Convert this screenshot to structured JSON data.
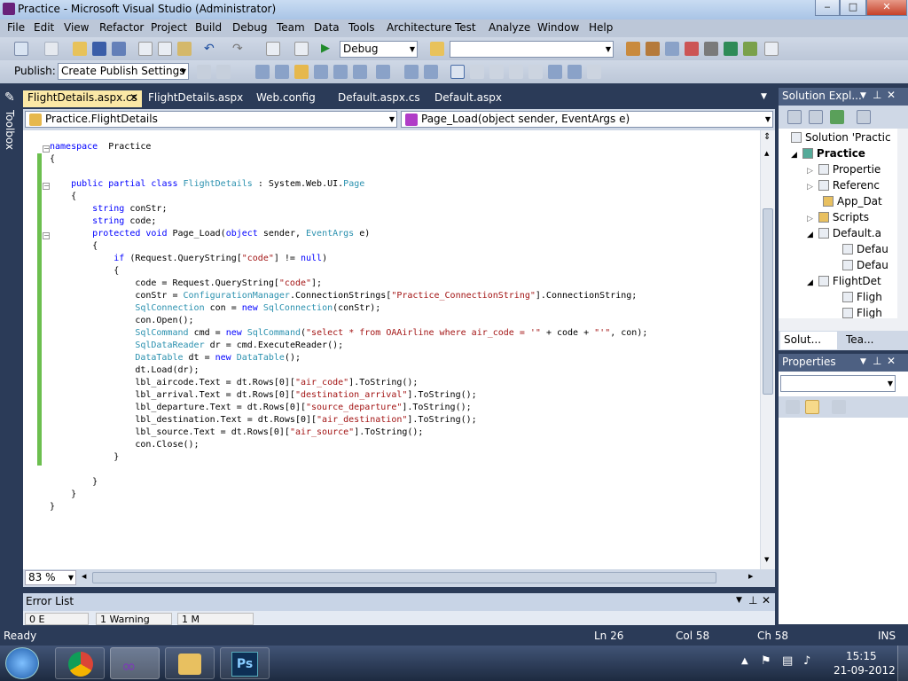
{
  "window": {
    "title": "Practice - Microsoft Visual Studio (Administrator)",
    "min": "‒",
    "max": "□",
    "close": "✕"
  },
  "menu": [
    "File",
    "Edit",
    "View",
    "Refactor",
    "Project",
    "Build",
    "Debug",
    "Team",
    "Data",
    "Tools",
    "Architecture",
    "Test",
    "Analyze",
    "Window",
    "Help"
  ],
  "toolbar": {
    "config": "Debug",
    "platform": "",
    "publish_label": "Publish:",
    "publish_profile": "Create Publish Settings"
  },
  "toolbox_label": "Toolbox",
  "tabs": [
    "FlightDetails.aspx.cs",
    "FlightDetails.aspx",
    "Web.config",
    "Default.aspx.cs",
    "Default.aspx"
  ],
  "tab_close": "✕",
  "nav": {
    "class": "Practice.FlightDetails",
    "member": "Page_Load(object sender, EventArgs e)"
  },
  "code_lines": [
    [
      [
        "kw",
        "namespace"
      ],
      [
        "",
        "  Practice"
      ]
    ],
    [
      [
        "",
        "{"
      ]
    ],
    [
      [
        "",
        ""
      ]
    ],
    [
      [
        "",
        "    "
      ],
      [
        "kw",
        "public partial class"
      ],
      [
        "",
        ""
      ],
      [
        "ty",
        " FlightDetails"
      ],
      [
        "",
        " : System.Web.UI."
      ],
      [
        "ty",
        "Page"
      ]
    ],
    [
      [
        "",
        "    {"
      ]
    ],
    [
      [
        "",
        "        "
      ],
      [
        "kw",
        "string"
      ],
      [
        "",
        " conStr;"
      ]
    ],
    [
      [
        "",
        "        "
      ],
      [
        "kw",
        "string"
      ],
      [
        "",
        " code;"
      ]
    ],
    [
      [
        "",
        "        "
      ],
      [
        "kw",
        "protected void"
      ],
      [
        "",
        " Page_Load("
      ],
      [
        "kw",
        "object"
      ],
      [
        "",
        " sender, "
      ],
      [
        "ty",
        "EventArgs"
      ],
      [
        "",
        " e)"
      ]
    ],
    [
      [
        "",
        "        {"
      ]
    ],
    [
      [
        "",
        "            "
      ],
      [
        "kw",
        "if"
      ],
      [
        "",
        " (Request.QueryString["
      ],
      [
        "st",
        "\"code\""
      ],
      [
        "",
        "] != "
      ],
      [
        "kw",
        "null"
      ],
      [
        "",
        ")"
      ]
    ],
    [
      [
        "",
        "            {"
      ]
    ],
    [
      [
        "",
        "                code = Request.QueryString["
      ],
      [
        "st",
        "\"code\""
      ],
      [
        "",
        "];"
      ]
    ],
    [
      [
        "",
        "                conStr = "
      ],
      [
        "ty",
        "ConfigurationManager"
      ],
      [
        "",
        ".ConnectionStrings["
      ],
      [
        "st",
        "\"Practice_ConnectionString\""
      ],
      [
        "",
        "].ConnectionString;"
      ]
    ],
    [
      [
        "",
        "                "
      ],
      [
        "ty",
        "SqlConnection"
      ],
      [
        "",
        " con = "
      ],
      [
        "kw",
        "new"
      ],
      [
        "ty",
        " SqlConnection"
      ],
      [
        "",
        "(conStr);"
      ]
    ],
    [
      [
        "",
        "                con.Open();"
      ]
    ],
    [
      [
        "",
        "                "
      ],
      [
        "ty",
        "SqlCommand"
      ],
      [
        "",
        " cmd = "
      ],
      [
        "kw",
        "new"
      ],
      [
        "ty",
        " SqlCommand"
      ],
      [
        "",
        "("
      ],
      [
        "st",
        "\"select * from OAAirline where air_code = '\""
      ],
      [
        "",
        " + code + "
      ],
      [
        "st",
        "\"'\""
      ],
      [
        "",
        ", con);"
      ]
    ],
    [
      [
        "",
        "                "
      ],
      [
        "ty",
        "SqlDataReader"
      ],
      [
        "",
        " dr = cmd.ExecuteReader();"
      ]
    ],
    [
      [
        "",
        "                "
      ],
      [
        "ty",
        "DataTable"
      ],
      [
        "",
        " dt = "
      ],
      [
        "kw",
        "new"
      ],
      [
        "ty",
        " DataTable"
      ],
      [
        "",
        "();"
      ]
    ],
    [
      [
        "",
        "                dt.Load(dr);"
      ]
    ],
    [
      [
        "",
        "                lbl_aircode.Text = dt.Rows[0]["
      ],
      [
        "st",
        "\"air_code\""
      ],
      [
        "",
        "].ToString();"
      ]
    ],
    [
      [
        "",
        "                lbl_arrival.Text = dt.Rows[0]["
      ],
      [
        "st",
        "\"destination_arrival\""
      ],
      [
        "",
        "].ToString();"
      ]
    ],
    [
      [
        "",
        "                lbl_departure.Text = dt.Rows[0]["
      ],
      [
        "st",
        "\"source_departure\""
      ],
      [
        "",
        "].ToString();"
      ]
    ],
    [
      [
        "",
        "                lbl_destination.Text = dt.Rows[0]["
      ],
      [
        "st",
        "\"air_destination\""
      ],
      [
        "",
        "].ToString();"
      ]
    ],
    [
      [
        "",
        "                lbl_source.Text = dt.Rows[0]["
      ],
      [
        "st",
        "\"air_source\""
      ],
      [
        "",
        "].ToString();"
      ]
    ],
    [
      [
        "",
        "                con.Close();"
      ]
    ],
    [
      [
        "",
        "            }"
      ]
    ],
    [
      [
        "",
        ""
      ]
    ],
    [
      [
        "",
        "        }"
      ]
    ],
    [
      [
        "",
        "    }"
      ]
    ],
    [
      [
        "",
        "}"
      ]
    ]
  ],
  "zoom": "83 %",
  "error_list": {
    "title": "Error List",
    "tabs": [
      "0 E",
      "1 Warning",
      "1 M"
    ]
  },
  "solution": {
    "title": "Solution Expl...",
    "items": [
      "Solution 'Practic",
      "Practice",
      "Propertie",
      "Referenc",
      "App_Dat",
      "Scripts",
      "Default.a",
      "Defau",
      "Defau",
      "FlightDet",
      "Fligh",
      "Fligh"
    ],
    "tabs": [
      "Solut...",
      "Tea..."
    ]
  },
  "properties": {
    "title": "Properties"
  },
  "status": {
    "ready": "Ready",
    "ln": "Ln 26",
    "col": "Col 58",
    "ch": "Ch 58",
    "mode": "INS"
  },
  "taskbar": {
    "time": "15:15",
    "date": "21-09-2012"
  },
  "colors": {
    "keyword": "#0000ff",
    "type": "#2b91af",
    "string": "#a31515",
    "active_tab": "#fbe8a6"
  }
}
